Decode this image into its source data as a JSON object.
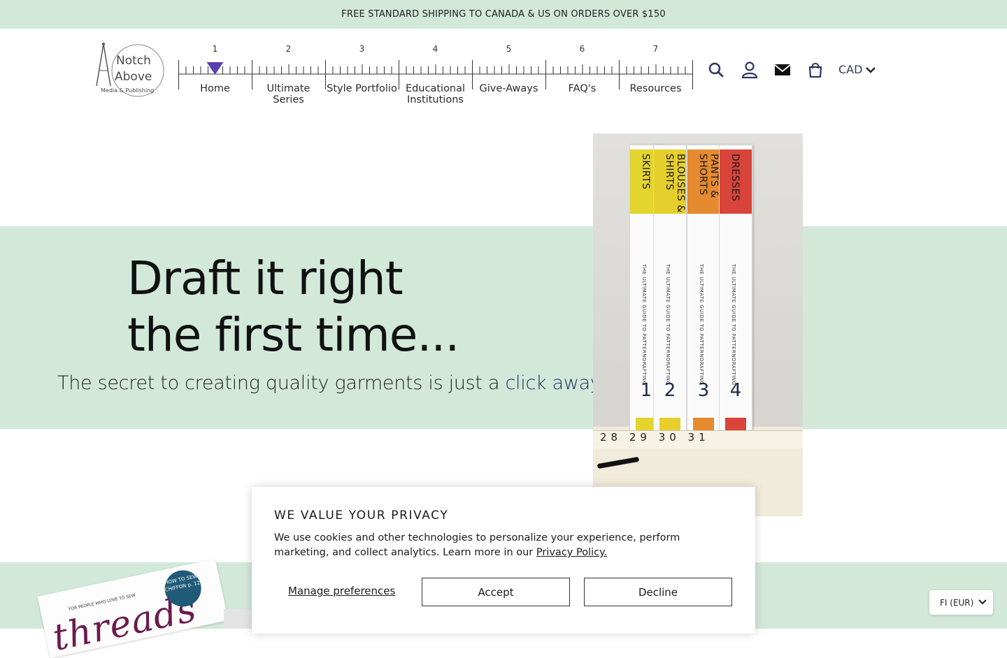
{
  "announcement": "FREE STANDARD SHIPPING TO CANADA & US ON ORDERS OVER $150",
  "logo": {
    "line1": "Notch",
    "line2": "Above",
    "line3": "Media & Publishing"
  },
  "nav": {
    "numbers": [
      "1",
      "2",
      "3",
      "4",
      "5",
      "6",
      "7"
    ],
    "items": [
      {
        "label": "Home",
        "line2": ""
      },
      {
        "label": "Ultimate",
        "line2": "Series"
      },
      {
        "label": "Style Portfolio",
        "line2": ""
      },
      {
        "label": "Educational",
        "line2": "Institutions"
      },
      {
        "label": "Give-Aways",
        "line2": ""
      },
      {
        "label": "FAQ's",
        "line2": ""
      },
      {
        "label": "Resources",
        "line2": ""
      }
    ],
    "active_index": 0
  },
  "header_icons": [
    "search-icon",
    "account-icon",
    "mail-icon",
    "cart-icon"
  ],
  "currency": "CAD",
  "hero": {
    "title_line1": "Draft it right",
    "title_line2": "the first time...",
    "subtitle_prefix": "The secret to creating quality garments is just a ",
    "subtitle_link": "click away!"
  },
  "hero_image": {
    "books": [
      {
        "title": "SKIRTS",
        "subtitle": "THE ULTIMATE GUIDE TO PATTERNDRAFTING",
        "number": "1",
        "color": "#e3d42e"
      },
      {
        "title": "BLOUSES & SHIRTS",
        "subtitle": "THE ULTIMATE GUIDE TO PATTERNDRAFTING",
        "number": "2",
        "color": "#e6cf2c"
      },
      {
        "title": "PANTS & SHORTS",
        "subtitle": "THE ULTIMATE GUIDE TO PATTERNDRAFTING",
        "number": "3",
        "color": "#e58a2f"
      },
      {
        "title": "DRESSES",
        "subtitle": "THE ULTIMATE GUIDE TO PATTERNDRAFTING",
        "number": "4",
        "color": "#d9443a"
      }
    ],
    "tape_numbers": "28 29 30 31"
  },
  "magazine": {
    "title": "threads",
    "tagline": "FOR PEOPLE WHO LOVE TO SEW",
    "badge": "HOW TO SEW CHIFFON p. 12"
  },
  "consent": {
    "heading": "WE VALUE YOUR PRIVACY",
    "body": "We use cookies and other technologies to personalize your experience, perform marketing, and collect analytics. Learn more in our ",
    "policy_link": "Privacy Policy.",
    "manage_label": "Manage preferences",
    "accept_label": "Accept",
    "decline_label": "Decline"
  },
  "language_selector": "FI (EUR)",
  "colors": {
    "mint": "#d2e9da",
    "active_marker": "#5b3fb2",
    "link_navy": "#17305e"
  }
}
